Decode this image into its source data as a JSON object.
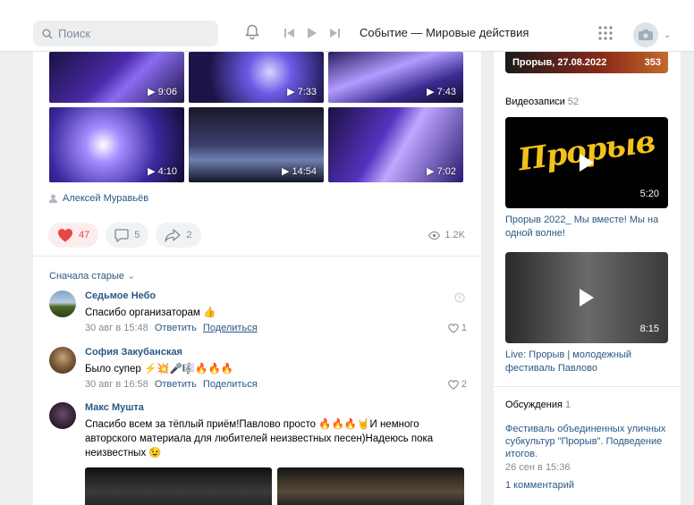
{
  "header": {
    "search_placeholder": "Поиск",
    "now_playing": "Событие — Мировые действия"
  },
  "post": {
    "videos": [
      {
        "duration": "9:06"
      },
      {
        "duration": "7:33"
      },
      {
        "duration": "7:43"
      },
      {
        "duration": "4:10"
      },
      {
        "duration": "14:54"
      },
      {
        "duration": "7:02"
      }
    ],
    "author": "Алексей Муравьёв",
    "likes": "47",
    "comments": "5",
    "shares": "2",
    "views": "1.2K",
    "sort_label": "Сначала старые"
  },
  "comments": [
    {
      "name": "Седьмое Небо",
      "text": "Спасибо организаторам 👍",
      "date": "30 авг в 15:48",
      "reply": "Ответить",
      "share": "Поделиться",
      "likes": "1"
    },
    {
      "name": "София Закубанская",
      "text": "Было супер ⚡💥🎤🎼🔥🔥🔥",
      "date": "30 авг в 16:58",
      "reply": "Ответить",
      "share": "Поделиться",
      "likes": "2"
    },
    {
      "name": "Макс Мушта",
      "text": "Спасибо всем за тёплый приём!Павлово просто 🔥🔥🔥🤘И немного авторского материала для любителей неизвестных песен)Надеюсь пока неизвестных 😉"
    }
  ],
  "sidebar": {
    "top_label": "Прорыв, 27.08.2022",
    "top_count": "353",
    "videos_title": "Видеозаписи",
    "videos_count": "52",
    "video1": {
      "duration": "5:20",
      "title": "Прорыв 2022_ Мы вместе! Мы на одной волне!",
      "overlay": "Прорыв"
    },
    "video2": {
      "duration": "8:15",
      "title": "Live: Прорыв | молодежный фестиваль Павлово"
    },
    "discussions_title": "Обсуждения",
    "discussions_count": "1",
    "discussion": {
      "title": "Фестиваль объединенных уличных субкультур \"Прорыв\". Подведение итогов.",
      "date": "26 сен в 15:36",
      "comments": "1 комментарий"
    }
  },
  "colors": {
    "accent": "#2a5885",
    "like": "#e64646",
    "bg": "#edeef0"
  }
}
